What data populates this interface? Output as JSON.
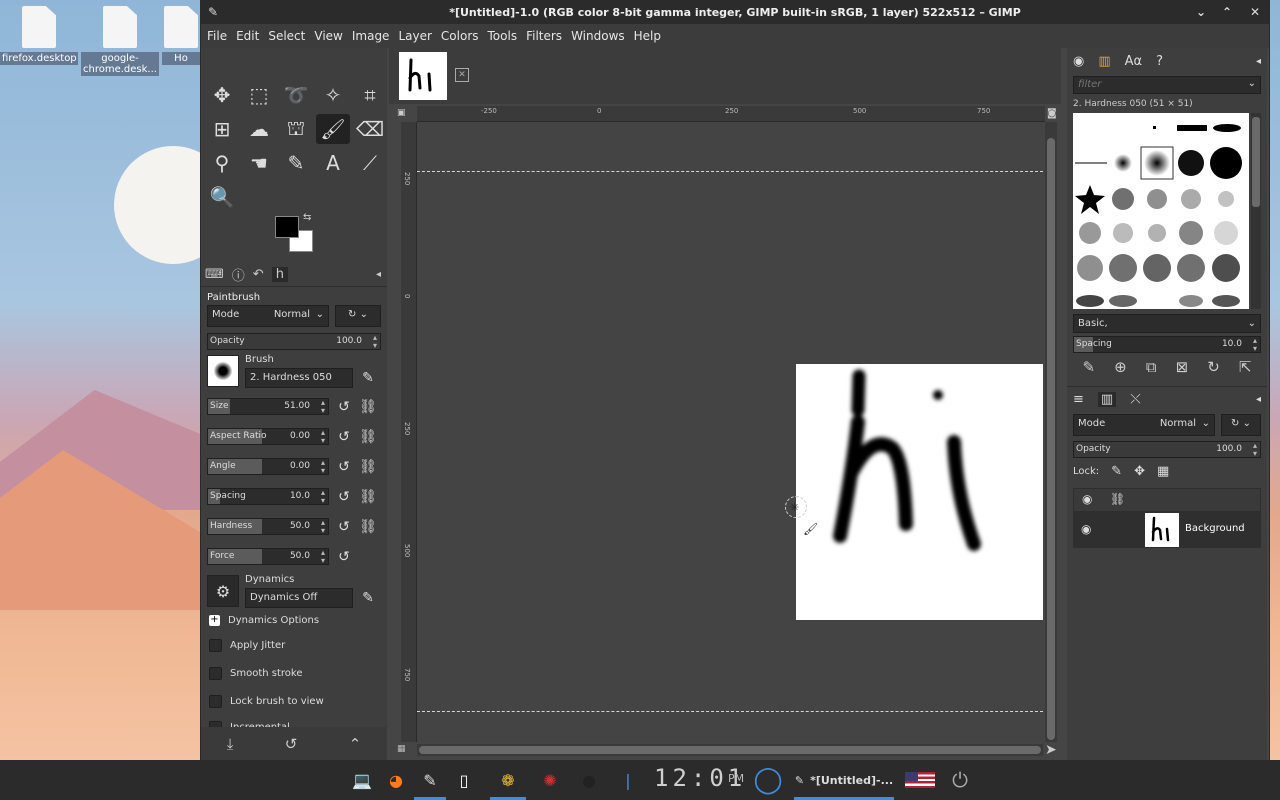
{
  "desktop": {
    "icons": [
      {
        "label": "firefox.desktop"
      },
      {
        "label": "google-chrome.desk..."
      },
      {
        "label": "Ho"
      }
    ]
  },
  "window": {
    "title": "*[Untitled]-1.0 (RGB color 8-bit gamma integer, GIMP built-in sRGB, 1 layer) 522x512 – GIMP",
    "menu": [
      "File",
      "Edit",
      "Select",
      "View",
      "Image",
      "Layer",
      "Colors",
      "Tools",
      "Filters",
      "Windows",
      "Help"
    ]
  },
  "toolbox": {
    "tools": [
      {
        "name": "move-tool",
        "glyph": "✥"
      },
      {
        "name": "rect-select-tool",
        "glyph": "⬚"
      },
      {
        "name": "lasso-tool",
        "glyph": "➰"
      },
      {
        "name": "fuzzy-select-tool",
        "glyph": "✧"
      },
      {
        "name": "crop-tool",
        "glyph": "⌗"
      },
      {
        "name": "transform-tool",
        "glyph": "⊞"
      },
      {
        "name": "warp-tool",
        "glyph": "☁"
      },
      {
        "name": "bucket-fill-tool",
        "glyph": "⛫"
      },
      {
        "name": "paintbrush-tool",
        "glyph": "🖌"
      },
      {
        "name": "eraser-tool",
        "glyph": "⌫"
      },
      {
        "name": "clone-tool",
        "glyph": "⚲"
      },
      {
        "name": "smudge-tool",
        "glyph": "☚"
      },
      {
        "name": "paths-tool",
        "glyph": "✎"
      },
      {
        "name": "text-tool",
        "glyph": "A"
      },
      {
        "name": "color-picker-tool",
        "glyph": "⟋"
      },
      {
        "name": "zoom-tool",
        "glyph": "🔍"
      }
    ],
    "fg_color": "#000000",
    "bg_color": "#ffffff"
  },
  "tool_options": {
    "title": "Paintbrush",
    "mode_label": "Mode",
    "mode_value": "Normal",
    "opacity_label": "Opacity",
    "opacity_value": "100.0",
    "brush_label": "Brush",
    "brush_value": "2. Hardness 050",
    "size_label": "Size",
    "size_value": "51.00",
    "aspect_label": "Aspect Ratio",
    "aspect_value": "0.00",
    "angle_label": "Angle",
    "angle_value": "0.00",
    "spacing_label": "Spacing",
    "spacing_value": "10.0",
    "hardness_label": "Hardness",
    "hardness_value": "50.0",
    "force_label": "Force",
    "force_value": "50.0",
    "dynamics_label": "Dynamics",
    "dynamics_value": "Dynamics Off",
    "dynamics_options": "Dynamics Options",
    "apply_jitter": "Apply Jitter",
    "smooth_stroke": "Smooth stroke",
    "lock_brush": "Lock brush to view",
    "incremental": "Incremental"
  },
  "rulers": {
    "h_ticks": [
      "-250",
      "0",
      "250",
      "500",
      "750"
    ],
    "v_ticks": [
      "250",
      "0",
      "250",
      "500",
      "750"
    ]
  },
  "brushes": {
    "filter_placeholder": "filter",
    "selected": "2. Hardness 050 (51 × 51)",
    "tag": "Basic,",
    "spacing_label": "Spacing",
    "spacing_value": "10.0"
  },
  "layers": {
    "mode_label": "Mode",
    "mode_value": "Normal",
    "opacity_label": "Opacity",
    "opacity_value": "100.0",
    "lock_label": "Lock:",
    "layer_name": "Background"
  },
  "taskbar": {
    "clock": "12:01",
    "ampm": "PM",
    "gimp_task": "*[Untitled]-..."
  }
}
